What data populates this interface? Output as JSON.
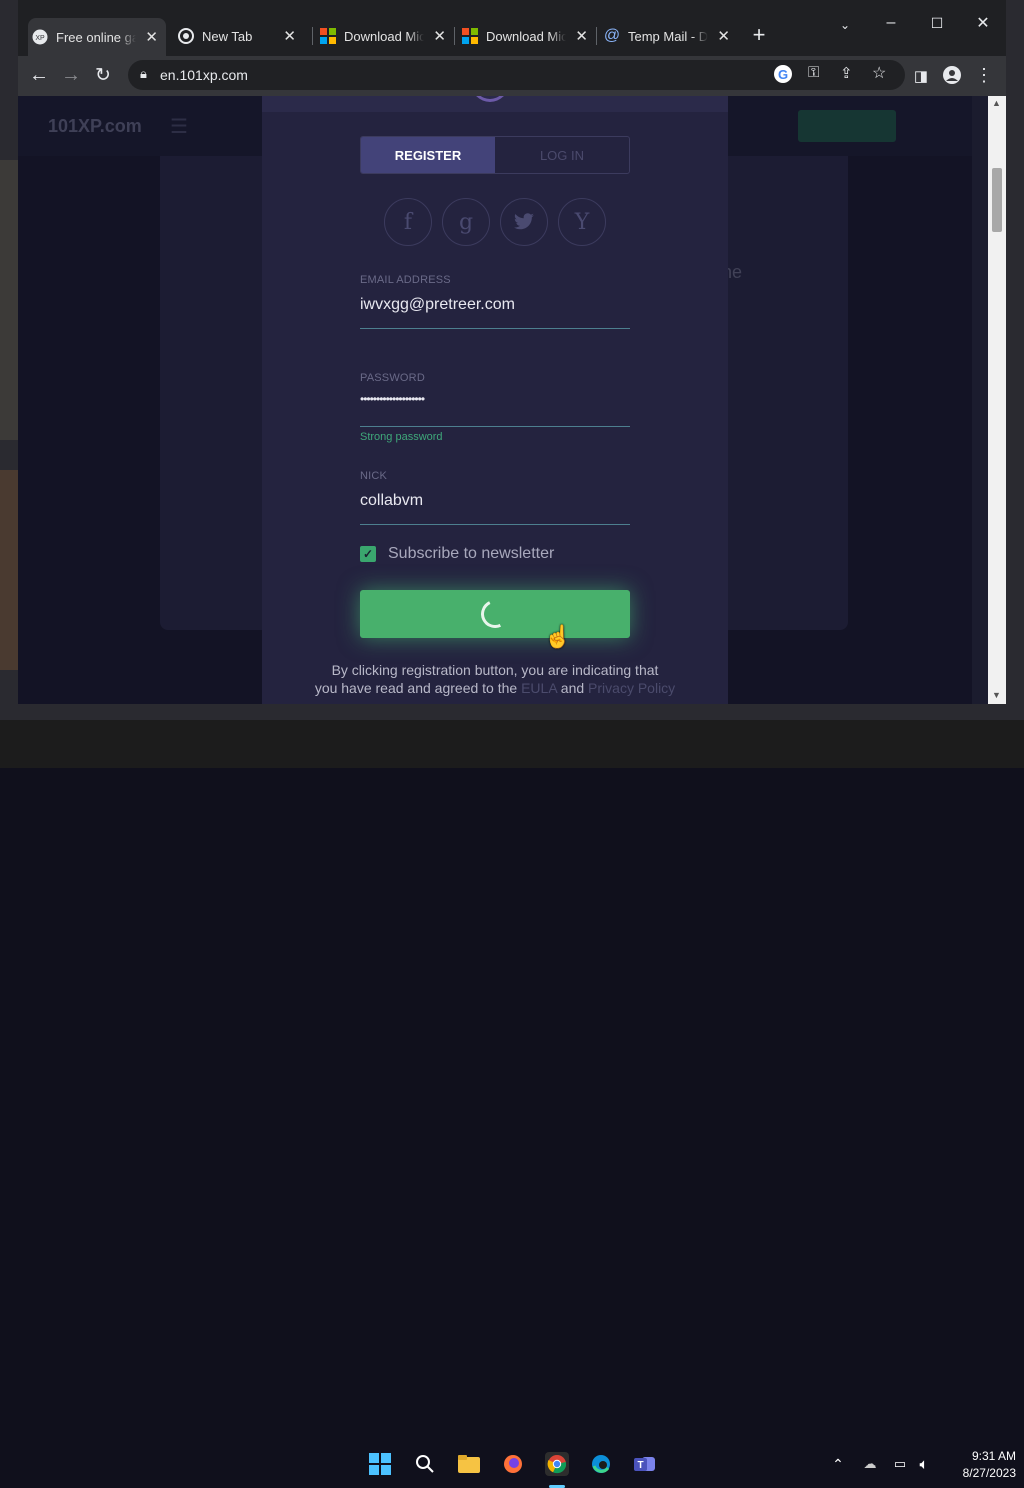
{
  "browser": {
    "tabs": [
      {
        "title": "Free online ga",
        "favicon": "xp-icon",
        "active": true
      },
      {
        "title": "New Tab",
        "favicon": "chrome-icon",
        "active": false
      },
      {
        "title": "Download Mic",
        "favicon": "microsoft-icon",
        "active": false
      },
      {
        "title": "Download Mic",
        "favicon": "microsoft-icon",
        "active": false
      },
      {
        "title": "Temp Mail - Di",
        "favicon": "at-icon",
        "active": false
      }
    ],
    "url": "en.101xp.com"
  },
  "site": {
    "logo": "101XP.com",
    "bg_text": "ne"
  },
  "modal": {
    "tab_register": "REGISTER",
    "tab_login": "LOG IN",
    "social": [
      "f",
      "g",
      "t",
      "Y"
    ],
    "email_label": "EMAIL ADDRESS",
    "email_value": "iwvxgg@pretreer.com",
    "password_label": "PASSWORD",
    "password_value": "••••••••••••••••••••",
    "password_hint": "Strong password",
    "nick_label": "NICK",
    "nick_value": "collabvm",
    "newsletter_label": "Subscribe to newsletter",
    "newsletter_checked": true,
    "terms_line1": "By clicking registration button, you are indicating that",
    "terms_line2_a": "you have read and agreed to the",
    "terms_eula": "EULA",
    "terms_and": "and",
    "terms_privacy": "Privacy Policy"
  },
  "taskbar": {
    "time": "9:31 AM",
    "date": "8/27/2023"
  },
  "colors": {
    "accent_green": "#48b06c",
    "modal_bg": "#24233f"
  }
}
